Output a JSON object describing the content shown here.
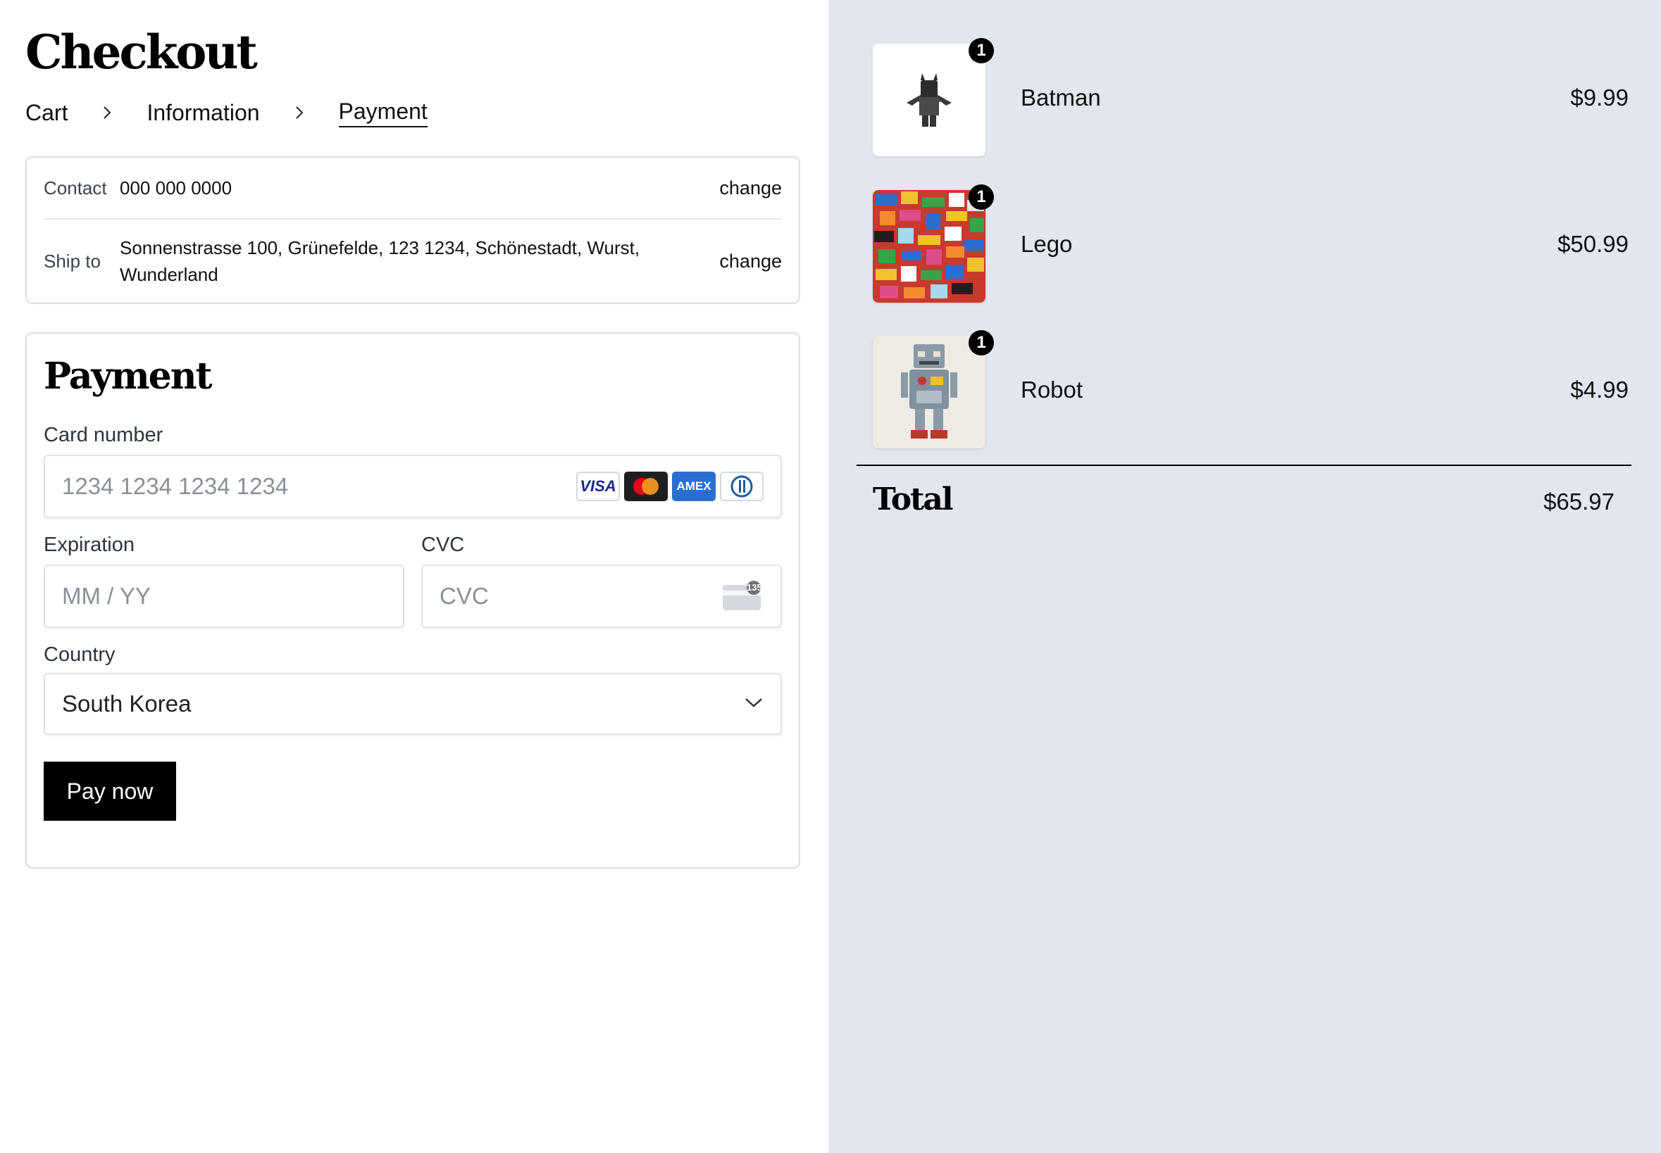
{
  "page": {
    "title": "Checkout"
  },
  "breadcrumb": {
    "items": [
      {
        "label": "Cart"
      },
      {
        "label": "Information"
      },
      {
        "label": "Payment",
        "active": true
      }
    ]
  },
  "summary": {
    "contact_label": "Contact",
    "contact_value": "000 000 0000",
    "shipto_label": "Ship to",
    "shipto_value": "Sonnenstrasse 100, Grünefelde, 123 1234, Schönestadt, Wurst, Wunderland",
    "change_label": "change"
  },
  "payment": {
    "title": "Payment",
    "card_number_label": "Card number",
    "card_number_placeholder": "1234 1234 1234 1234",
    "card_logos": [
      "VISA",
      "mastercard",
      "AMEX",
      "diners"
    ],
    "expiration_label": "Expiration",
    "expiration_placeholder": "MM / YY",
    "cvc_label": "CVC",
    "cvc_placeholder": "CVC",
    "cvc_icon_text": "135",
    "country_label": "Country",
    "country_value": "South Korea",
    "pay_button_label": "Pay now"
  },
  "cart": {
    "items": [
      {
        "name": "Batman",
        "price": "$9.99",
        "quantity": "1",
        "image": "batman-figure"
      },
      {
        "name": "Lego",
        "price": "$50.99",
        "quantity": "1",
        "image": "lego-bricks"
      },
      {
        "name": "Robot",
        "price": "$4.99",
        "quantity": "1",
        "image": "tin-robot"
      }
    ],
    "total_label": "Total",
    "total_value": "$65.97"
  },
  "colors": {
    "sidebar_bg": "#e2e6ee",
    "button_bg": "#000000",
    "border": "#d9dde5"
  }
}
